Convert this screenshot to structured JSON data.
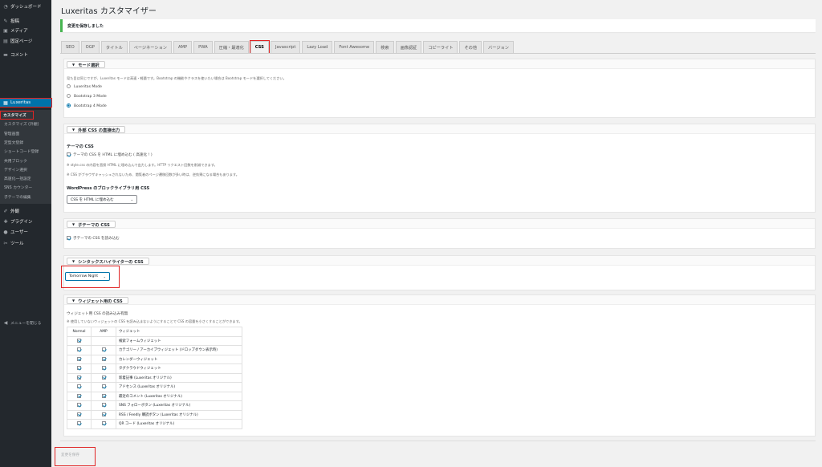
{
  "sidebar": {
    "top_items": [
      {
        "label": "ダッシュボード",
        "icon": "dashboard-icon",
        "glyph": "◔"
      },
      {
        "label": "投稿",
        "icon": "pin-icon",
        "glyph": "✎"
      },
      {
        "label": "メディア",
        "icon": "media-icon",
        "glyph": "▣"
      },
      {
        "label": "固定ページ",
        "icon": "page-icon",
        "glyph": "▤"
      },
      {
        "label": "コメント",
        "icon": "comment-icon",
        "glyph": "▬"
      }
    ],
    "luxeritas": {
      "label": "Luxeritas",
      "icon": "luxeritas-icon",
      "glyph": "▦"
    },
    "submenu": [
      "カスタマイズ",
      "カスタマイズ (外観)",
      "管理画面",
      "定型文登録",
      "ショートコード登録",
      "共用ブロック",
      "デザイン選択",
      "高速化一括設定",
      "SNS カウンター",
      "子テーマの編集"
    ],
    "bottom_items": [
      {
        "label": "外観",
        "icon": "appearance-icon",
        "glyph": "✐"
      },
      {
        "label": "プラグイン",
        "icon": "plugin-icon",
        "glyph": "✚"
      },
      {
        "label": "ユーザー",
        "icon": "user-icon",
        "glyph": "●"
      },
      {
        "label": "ツール",
        "icon": "tool-icon",
        "glyph": "✂"
      }
    ],
    "collapse_label": "メニューを閉じる"
  },
  "header": {
    "title": "Luxeritas カスタマイザー",
    "notice": "変更を保存しました"
  },
  "tabs": [
    "SEO",
    "OGP",
    "タイトル",
    "ページネーション",
    "AMP",
    "PWA",
    "圧縮・最適化",
    "CSS",
    "Javascript",
    "Lazy Load",
    "Font Awesome",
    "検索",
    "画像認証",
    "コピーライト",
    "その他",
    "バージョン"
  ],
  "active_tab": "CSS",
  "mode_panel": {
    "legend": "モード選択",
    "description": "見た目は同じですが、Luxeritas モードは高速・軽量です。Bootstrap の機能やクラスを使いたい場合は Bootstrap モードを選択してください。",
    "options": [
      "Luxeritas Mode",
      "Bootstrap 3 Mode",
      "Bootstrap 4 Mode"
    ],
    "selected": "Bootstrap 4 Mode"
  },
  "external_css_panel": {
    "legend": "外部 CSS の直接出力",
    "theme_css_heading": "テーマの CSS",
    "theme_css_checkbox": "テーマの CSS を HTML に埋め込む ( 高速化 ! )",
    "note1": "※ style.css の内容を直接 HTML に埋め込んで出力します。HTTP リクエスト回数を削減できます。",
    "note2": "※ CSS がブラウザキャッシュされないため、閲覧者のページ遷移回数が多い時は、逆効果になる場合もあります。",
    "block_css_heading": "WordPress のブロックライブラリ用 CSS",
    "block_css_select": "CSS を HTML に埋め込む"
  },
  "child_panel": {
    "legend": "子テーマの CSS",
    "checkbox": "子テーマの CSS を読み込む"
  },
  "syntax_panel": {
    "legend": "シンタックスハイライターの CSS",
    "select": "Tomorrow Night"
  },
  "widget_panel": {
    "legend": "ウィジェット用の CSS",
    "heading": "ウィジェット用 CSS の読み込み有無",
    "note": "※ 使用していないウィジェットの CSS を読み込まないようにすることで CSS の容量を小さくすることができます。",
    "columns": [
      "Normal",
      "AMP",
      "ウィジェット"
    ],
    "rows": [
      {
        "name": "検索フォームウィジェット",
        "normal": true,
        "amp": false
      },
      {
        "name": "カテゴリー / アーカイブウィジェット (ドロップダウン表示時)",
        "normal": true,
        "amp": true
      },
      {
        "name": "カレンダーウィジェット",
        "normal": true,
        "amp": true
      },
      {
        "name": "タグクラウドウィジェット",
        "normal": true,
        "amp": true
      },
      {
        "name": "新着記事 (Luxeritas オリジナル)",
        "normal": true,
        "amp": true
      },
      {
        "name": "アドセンス (Luxeritas オリジナル)",
        "normal": true,
        "amp": true
      },
      {
        "name": "最近のコメント (Luxeritas オリジナル)",
        "normal": true,
        "amp": true
      },
      {
        "name": "SNS フォローボタン (Luxeritas オリジナル)",
        "normal": true,
        "amp": true
      },
      {
        "name": "RSS / Feedly 購読ボタン (Luxeritas オリジナル)",
        "normal": true,
        "amp": true
      },
      {
        "name": "QR コード (Luxeritas オリジナル)",
        "normal": true,
        "amp": true
      }
    ]
  },
  "footer": {
    "save_label": "変更を保存"
  },
  "colors": {
    "accent": "#0073aa",
    "highlight_box": "#e02424",
    "notice_border": "#46b450",
    "sidebar_bg": "#23282d"
  }
}
